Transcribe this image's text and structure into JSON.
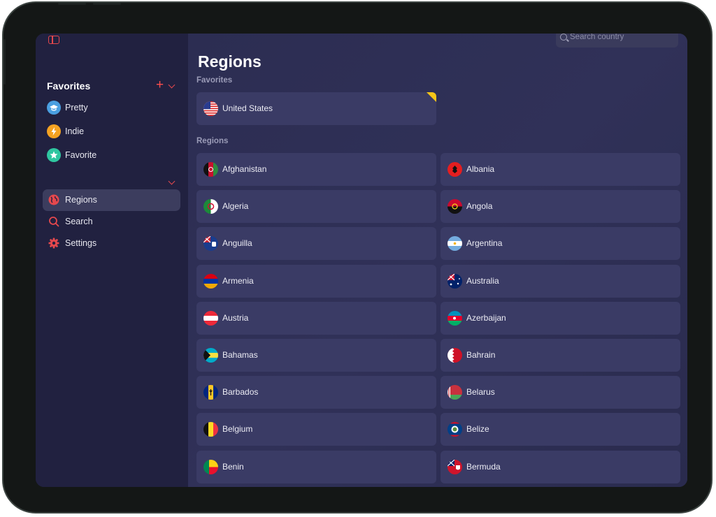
{
  "app": {
    "title": "Regions"
  },
  "search": {
    "placeholder": "Search country"
  },
  "sidebar": {
    "favorites_heading": "Favorites",
    "favorites": [
      {
        "label": "Pretty",
        "icon": "graduation-cap-icon",
        "color": "#4a9fe0"
      },
      {
        "label": "Indie",
        "icon": "lightning-icon",
        "color": "#f4a222"
      },
      {
        "label": "Favorite",
        "icon": "star-icon",
        "color": "#2fc6a0"
      }
    ],
    "nav": [
      {
        "label": "Regions",
        "icon": "globe-icon",
        "active": true
      },
      {
        "label": "Search",
        "icon": "search-icon",
        "active": false
      },
      {
        "label": "Settings",
        "icon": "gear-icon",
        "active": false
      }
    ]
  },
  "main": {
    "title": "Regions",
    "favorites_label": "Favorites",
    "regions_label": "Regions",
    "favorite_countries": [
      {
        "name": "United States",
        "flag": "flag-us-icon"
      }
    ],
    "countries": [
      {
        "name": "Afghanistan",
        "flag": "flag-af-icon"
      },
      {
        "name": "Albania",
        "flag": "flag-al-icon"
      },
      {
        "name": "Algeria",
        "flag": "flag-dz-icon"
      },
      {
        "name": "Angola",
        "flag": "flag-ao-icon"
      },
      {
        "name": "Anguilla",
        "flag": "flag-ai-icon"
      },
      {
        "name": "Argentina",
        "flag": "flag-ar-icon"
      },
      {
        "name": "Armenia",
        "flag": "flag-am-icon"
      },
      {
        "name": "Australia",
        "flag": "flag-au-icon"
      },
      {
        "name": "Austria",
        "flag": "flag-at-icon"
      },
      {
        "name": "Azerbaijan",
        "flag": "flag-az-icon"
      },
      {
        "name": "Bahamas",
        "flag": "flag-bs-icon"
      },
      {
        "name": "Bahrain",
        "flag": "flag-bh-icon"
      },
      {
        "name": "Barbados",
        "flag": "flag-bb-icon"
      },
      {
        "name": "Belarus",
        "flag": "flag-by-icon"
      },
      {
        "name": "Belgium",
        "flag": "flag-be-icon"
      },
      {
        "name": "Belize",
        "flag": "flag-bz-icon"
      },
      {
        "name": "Benin",
        "flag": "flag-bj-icon"
      },
      {
        "name": "Bermuda",
        "flag": "flag-bm-icon"
      }
    ]
  },
  "colors": {
    "accent": "#e5484d",
    "sidebar_bg": "#212140",
    "main_bg": "#2e2f55",
    "card_bg": "#3a3b65",
    "favorite_corner": "#f5c518"
  }
}
